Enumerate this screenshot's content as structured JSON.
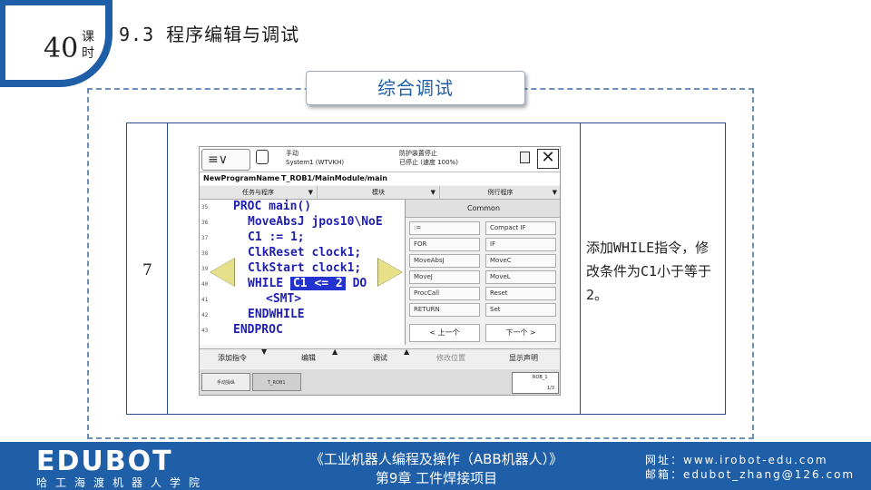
{
  "header": {
    "lesson_number": "40",
    "lesson_unit": "课时",
    "section_title": "9.3 程序编辑与调试"
  },
  "subtitle": "综合调试",
  "step": {
    "number": "7",
    "description": "添加WHILE指令，修改条件为C1小于等于2。"
  },
  "pendant": {
    "menu_glyph": "≡∨",
    "status_left": [
      "手动",
      "System1 (WTVKH)"
    ],
    "status_right": [
      "防护装置停止",
      "已停止 (速度 100%)"
    ],
    "close_glyph": "✕",
    "path_module": "NewProgramName",
    "path_routine": "T_ROB1/MainModule/main",
    "tabs": [
      "任务与程序",
      "模块",
      "例行程序"
    ],
    "line_numbers": [
      "35",
      "36",
      "37",
      "38",
      "39",
      "40",
      "41",
      "42",
      "43"
    ],
    "code": {
      "line1": "PROC main()",
      "line2": "MoveAbsJ jpos10\\NoE",
      "line3": "C1 := 1;",
      "line4": "ClkReset clock1;",
      "line5": "ClkStart clock1;",
      "line6_kw": "WHILE",
      "line6_cond": "C1 <= 2",
      "line6_do": "DO",
      "line7": "<SMT>",
      "line8": "ENDWHILE",
      "line9": "ENDPROC"
    },
    "panel_title": "Common",
    "commands": [
      ":=",
      "Compact IF",
      "FOR",
      "IF",
      "MoveAbsJ",
      "MoveC",
      "MoveJ",
      "MoveL",
      "ProcCall",
      "Reset",
      "RETURN",
      "Set"
    ],
    "page_prev": "< 上一个",
    "page_next": "下一个 >",
    "bottom_buttons": [
      "添加指令",
      "编辑",
      "调试",
      "修改位置",
      "显示声明"
    ],
    "tasks": [
      "手动操纵",
      "T_ROB1 MainModule"
    ],
    "indicator_label": "ROB_1",
    "indicator_fraction": "1/3"
  },
  "footer": {
    "logo": "EDUBOT",
    "logo_sub": "哈工海渡机器人学院",
    "book_title": "《工业机器人编程及操作（ABB机器人）》",
    "chapter": "第9章 工件焊接项目",
    "website": "网址：www.irobot-edu.com",
    "email": "邮箱：edubot_zhang@126.com"
  },
  "colors": {
    "brand_blue": "#1f5fa8",
    "code_blue": "#1f1fb0",
    "highlight": "#2432d0",
    "nav_yellow": "#e6e08a"
  }
}
